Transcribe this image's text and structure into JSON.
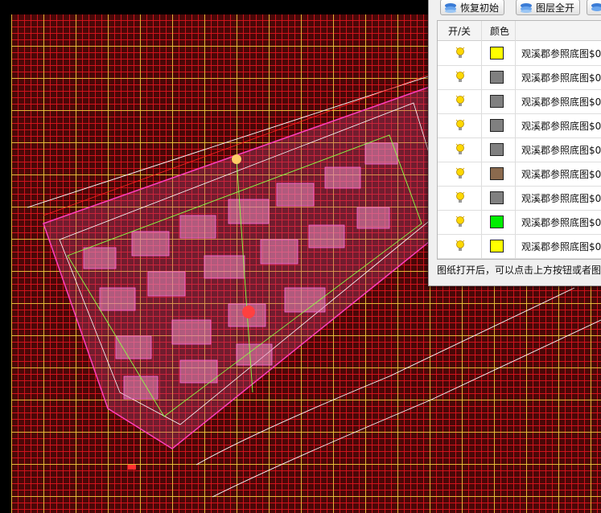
{
  "toolbar": {
    "restore_label": "恢复初始",
    "all_on_label": "图层全开"
  },
  "table": {
    "col_onoff": "开/关",
    "col_color": "颜色",
    "rows": [
      {
        "color": "#ffff00",
        "name": "观溪郡参照底图$0"
      },
      {
        "color": "#808080",
        "name": "观溪郡参照底图$0"
      },
      {
        "color": "#808080",
        "name": "观溪郡参照底图$0"
      },
      {
        "color": "#808080",
        "name": "观溪郡参照底图$0"
      },
      {
        "color": "#808080",
        "name": "观溪郡参照底图$0"
      },
      {
        "color": "#8b6a4e",
        "name": "观溪郡参照底图$0"
      },
      {
        "color": "#808080",
        "name": "观溪郡参照底图$0"
      },
      {
        "color": "#00ee00",
        "name": "观溪郡参照底图$0"
      },
      {
        "color": "#ffff00",
        "name": "观溪郡参照底图$0"
      }
    ]
  },
  "status_text": "图纸打开后，可以点击上方按钮或者图",
  "colors": {
    "background": "#000000",
    "grid_major": "#e6d23c",
    "grid_minor": "#dc141e",
    "site_lines": "#ff44cc",
    "highlight": "#ffe000"
  }
}
